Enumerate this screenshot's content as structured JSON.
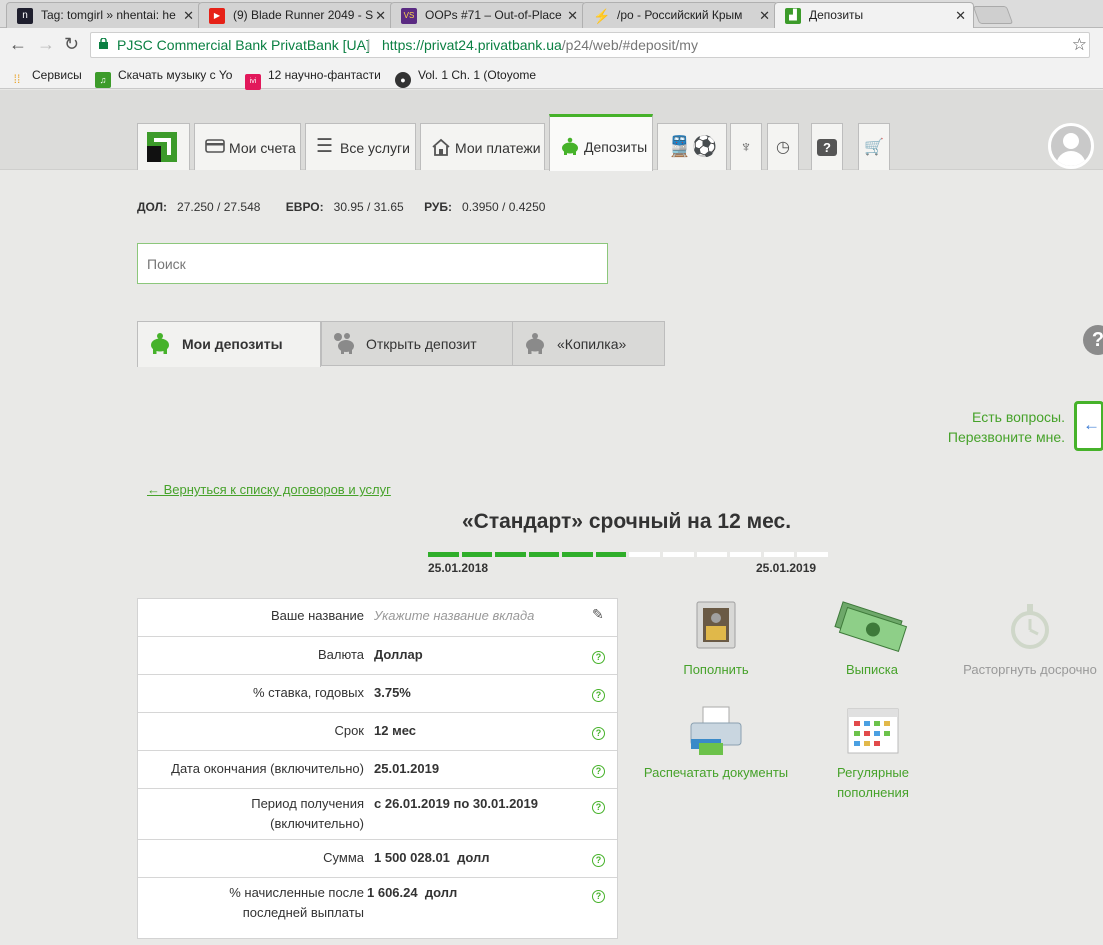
{
  "browser": {
    "tabs": [
      {
        "title": "Tag: tomgirl » nhentai: he",
        "favicon_color": "#1f1f2e",
        "favicon_text": "n"
      },
      {
        "title": "(9) Blade Runner 2049 - S",
        "favicon_color": "#e62117",
        "favicon_text": "▶"
      },
      {
        "title": "OOPs #71 – Out-of-Place",
        "favicon_color": "#5a2a82",
        "favicon_text": "VS"
      },
      {
        "title": "/po - Российский Крым",
        "favicon_color": "#f0a020",
        "favicon_text": "⚡"
      },
      {
        "title": "Депозиты",
        "favicon_color": "#3c9b2a",
        "favicon_text": "▟"
      }
    ],
    "active_tab_index": 4,
    "address": {
      "org": "PJSC Commercial Bank PrivatBank [UA]",
      "separator": "|",
      "url_host": "https://privat24.privatbank.ua",
      "url_path": "/p24/web/#deposit/my"
    },
    "bookmarks": [
      {
        "label": "Сервисы",
        "icon_color": "#e8a020"
      },
      {
        "label": "Скачать музыку с Yo",
        "icon_color": "#3c9b2a"
      },
      {
        "label": "12 научно-фантасти",
        "icon_color": "#e2185b"
      },
      {
        "label": "Vol. 1 Ch. 1 (Otoyome",
        "icon_color": "#333333"
      }
    ]
  },
  "nav": {
    "items": [
      {
        "label": "Мои счета",
        "icon": "card-icon"
      },
      {
        "label": "Все услуги",
        "icon": "list-icon"
      },
      {
        "label": "Мои платежи",
        "icon": "house-icon"
      },
      {
        "label": "Депозиты",
        "icon": "piggy-bank-icon",
        "active": true
      }
    ],
    "extra_icons": [
      "travel-icon",
      "football-icon",
      "trident-icon",
      "clock-icon",
      "question-icon",
      "cart-icon"
    ]
  },
  "rates": {
    "usd_label": "ДОЛ:",
    "usd_value": "27.250 / 27.548",
    "eur_label": "ЕВРО:",
    "eur_value": "30.95 / 31.65",
    "rub_label": "РУБ:",
    "rub_value": "0.3950 / 0.4250"
  },
  "search": {
    "placeholder": "Поиск"
  },
  "subtabs": [
    {
      "label": "Мои депозиты",
      "active": true
    },
    {
      "label": "Открыть депозит"
    },
    {
      "label": "«Копилка»"
    }
  ],
  "callback": {
    "line1": "Есть вопросы.",
    "line2": "Перезвоните мне."
  },
  "back_link": "← Вернуться к списку договоров и услуг",
  "deposit": {
    "title": "«Стандарт» срочный на 12 мес.",
    "date_start": "25.01.2018",
    "date_end": "25.01.2019",
    "progress_total_segments": 12,
    "progress_filled_segments": 6
  },
  "info_rows": [
    {
      "label": "Ваше название",
      "value": "Укажите название вклада",
      "placeholder": true,
      "icon": "pencil"
    },
    {
      "label": "Валюта",
      "value": "Доллар"
    },
    {
      "label": "% ставка, годовых",
      "value": "3.75%"
    },
    {
      "label": "Срок",
      "value": "12 мес"
    },
    {
      "label": "Дата окончания (включительно)",
      "value": "25.01.2019"
    },
    {
      "label": "Период получения (включительно)",
      "value": "с 26.01.2019 по 30.01.2019"
    },
    {
      "label": "Сумма",
      "value": "1 500 028.01  долл"
    },
    {
      "label": "% начисленные после последней выплаты",
      "value": "1 606.24  долл"
    }
  ],
  "actions": [
    {
      "label": "Пополнить",
      "icon": "safe-icon",
      "enabled": true
    },
    {
      "label": "Выписка",
      "icon": "money-icon",
      "enabled": true
    },
    {
      "label": "Расторгнуть досрочно",
      "icon": "stopwatch-icon",
      "enabled": false
    },
    {
      "label": "Распечатать документы",
      "icon": "printer-icon",
      "enabled": true
    },
    {
      "label": "Регулярные пополнения",
      "icon": "calendar-icon",
      "enabled": true
    }
  ]
}
